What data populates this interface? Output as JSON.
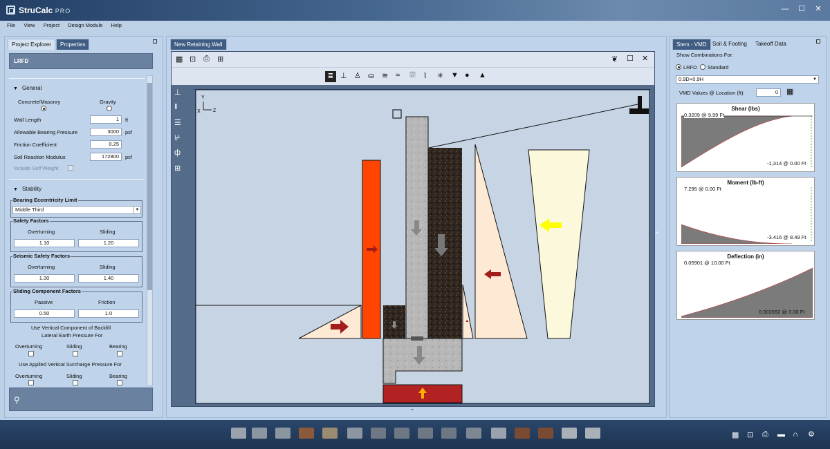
{
  "app": {
    "title": "StruCalc",
    "edition": "PRO"
  },
  "window_controls": {
    "minimize": "—",
    "maximize": "☐",
    "close": "✕"
  },
  "menu": [
    "File",
    "View",
    "Project",
    "Design Module",
    "Help"
  ],
  "left_panel": {
    "tabs": [
      "Project Explorer",
      "Properties"
    ],
    "active_tab": "Properties",
    "header": "LRFD",
    "general": {
      "title": "General",
      "wall_type_options": [
        "Concrete/Masonry",
        "Gravity"
      ],
      "wall_type_selected": "Concrete/Masonry",
      "fields": [
        {
          "label": "Wall Length",
          "value": "1",
          "unit": "ft"
        },
        {
          "label": "Allowable Bearing Pressure",
          "value": "3000",
          "unit": "psf"
        },
        {
          "label": "Friction Coefficient",
          "value": "0.25",
          "unit": ""
        },
        {
          "label": "Soil Reaction Modulus",
          "value": "172800",
          "unit": "pcf"
        }
      ],
      "include_self_weight": "Include Self Weight"
    },
    "stability": {
      "title": "Stability",
      "bearing_eccentricity": {
        "label": "Bearing Eccentricity Limit",
        "value": "Middle Third"
      },
      "safety_factors": {
        "label": "Safety Factors",
        "col1": "Overturning",
        "col2": "Sliding",
        "v1": "1.10",
        "v2": "1.20"
      },
      "seismic_safety_factors": {
        "label": "Seismic Safety Factors",
        "col1": "Overturning",
        "col2": "Sliding",
        "v1": "1.30",
        "v2": "1.40"
      },
      "sliding_component_factors": {
        "label": "Sliding Component Factors",
        "col1": "Passive",
        "col2": "Friction",
        "v1": "0.50",
        "v2": "1.0"
      },
      "vertical_backfill": {
        "line1": "Use Vertical Component of Backfill",
        "line2": "Lateral Earth Pressure For",
        "cols": [
          "Overturning",
          "Sliding",
          "Bearing"
        ]
      },
      "applied_surcharge": {
        "label": "Use Applied Vertical Surcharge Pressure For",
        "cols": [
          "Overturning",
          "Sliding",
          "Bearing"
        ]
      }
    }
  },
  "center": {
    "tab": "New Retaining Wall",
    "axes": {
      "y": "Y",
      "x": "X",
      "z": "Z"
    }
  },
  "right_panel": {
    "tabs": [
      "Stem - VMD",
      "Soil & Footing",
      "Takeoff Data"
    ],
    "active_tab": "Stem - VMD",
    "show_combinations_label": "Show Combinations For:",
    "options": [
      "LRFD",
      "Standard"
    ],
    "selected_option": "LRFD",
    "combination": "0.9D+0.9H",
    "vmd_location_label": "VMD Values @ Location (ft):",
    "vmd_location_value": "0",
    "charts": [
      {
        "title": "Shear (lbs)",
        "max_label": "0.3209 @ 9.99 Ft",
        "min_label": "-1,314 @ 0.00 Ft"
      },
      {
        "title": "Moment (lb-ft)",
        "max_label": "7.295 @ 0.00 Ft",
        "min_label": "-3.416 @ 8.49 Ft"
      },
      {
        "title": "Deflection (in)",
        "max_label": "0.05901 @ 10.00 Ft",
        "min_label": "0.002692 @ 0.00 Ft"
      }
    ]
  },
  "colors": {
    "accent": "#3f5c82",
    "passive_bar": "#ff4500",
    "footing_pressure": "#b22222",
    "yellow_arrow": "#ffff00",
    "pressure_fill": "#fde9d4"
  }
}
